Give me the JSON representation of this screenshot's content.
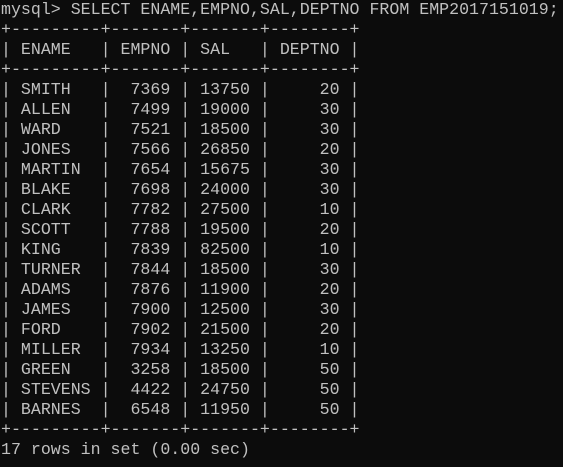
{
  "terminal": {
    "prompt": "mysql>",
    "command": "SELECT ENAME,EMPNO,SAL,DEPTNO FROM EMP2017151019;",
    "border": "+---------+-------+-------+--------+",
    "columns": [
      "ENAME",
      "EMPNO",
      "SAL",
      "DEPTNO"
    ],
    "rows": [
      [
        "SMITH",
        "7369",
        "13750",
        "20"
      ],
      [
        "ALLEN",
        "7499",
        "19000",
        "30"
      ],
      [
        "WARD",
        "7521",
        "18500",
        "30"
      ],
      [
        "JONES",
        "7566",
        "26850",
        "20"
      ],
      [
        "MARTIN",
        "7654",
        "15675",
        "30"
      ],
      [
        "BLAKE",
        "7698",
        "24000",
        "30"
      ],
      [
        "CLARK",
        "7782",
        "27500",
        "10"
      ],
      [
        "SCOTT",
        "7788",
        "19500",
        "20"
      ],
      [
        "KING",
        "7839",
        "82500",
        "10"
      ],
      [
        "TURNER",
        "7844",
        "18500",
        "30"
      ],
      [
        "ADAMS",
        "7876",
        "11900",
        "20"
      ],
      [
        "JAMES",
        "7900",
        "12500",
        "30"
      ],
      [
        "FORD",
        "7902",
        "21500",
        "20"
      ],
      [
        "MILLER",
        "7934",
        "13250",
        "10"
      ],
      [
        "GREEN",
        "3258",
        "18500",
        "50"
      ],
      [
        "STEVENS",
        "4422",
        "24750",
        "50"
      ],
      [
        "BARNES",
        "6548",
        "11950",
        "50"
      ]
    ],
    "summary": "17 rows in set (0.00 sec)"
  }
}
